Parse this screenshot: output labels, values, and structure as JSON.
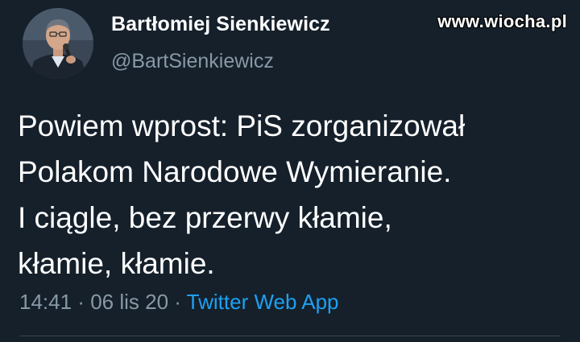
{
  "author": {
    "display_name": "Bartłomiej Sienkiewicz",
    "handle": "@BartSienkiewicz"
  },
  "watermark": "www.wiocha.pl",
  "tweet": {
    "lines": [
      "Powiem wprost: PiS zorganizował",
      "Polakom Narodowe Wymieranie.",
      "I ciągle, bez przerwy kłamie,",
      "kłamie, kłamie."
    ]
  },
  "meta": {
    "time": "14:41",
    "date": "06 lis 20",
    "separator": " · ",
    "source": "Twitter Web App"
  },
  "colors": {
    "background": "#15202b",
    "text": "#ffffff",
    "muted": "#8899a6",
    "link": "#1da1f2"
  }
}
